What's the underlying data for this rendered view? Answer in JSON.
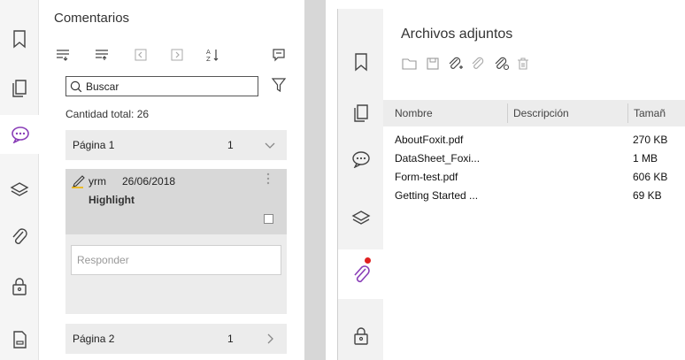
{
  "left_panel": {
    "title": "Comentarios",
    "rail_icons": [
      "bookmark-icon",
      "pages-icon",
      "comment-icon",
      "layers-icon",
      "attachment-icon",
      "lock-icon",
      "document-icon"
    ],
    "toolbar_icons": [
      "expand-all-icon",
      "collapse-all-icon",
      "previous-icon",
      "next-icon",
      "sort-icon",
      "comment-list-icon"
    ],
    "search_placeholder": "Buscar",
    "total_count": "Cantidad total: 26",
    "pages": [
      {
        "name": "Página 1",
        "count": "1"
      },
      {
        "name": "Página 2",
        "count": "1"
      }
    ],
    "comment": {
      "author": "yrm",
      "date": "26/06/2018",
      "type": "Highlight",
      "reply_placeholder": "Responder"
    }
  },
  "right_panel": {
    "title": "Archivos adjuntos",
    "rail_icons": [
      "bookmark-icon",
      "pages-icon",
      "comment-icon",
      "layers-icon",
      "attachment-icon",
      "lock-icon"
    ],
    "toolbar_icons": [
      "open-folder-icon",
      "save-icon",
      "add-attachment-icon",
      "remove-attachment-icon",
      "attachment-properties-icon",
      "delete-icon"
    ],
    "columns": [
      "Nombre",
      "Descripción",
      "Tamañ"
    ],
    "files": [
      {
        "name": "AboutFoxit.pdf",
        "size": "270 KB"
      },
      {
        "name": "DataSheet_Foxi...",
        "size": "1 MB"
      },
      {
        "name": "Form-test.pdf",
        "size": "606 KB"
      },
      {
        "name": "Getting Started ...",
        "size": "69 KB"
      }
    ]
  },
  "colors": {
    "accent_purple": "#8a3fb8",
    "notification_red": "#e02020",
    "highlight_underline": "#f0b400"
  }
}
